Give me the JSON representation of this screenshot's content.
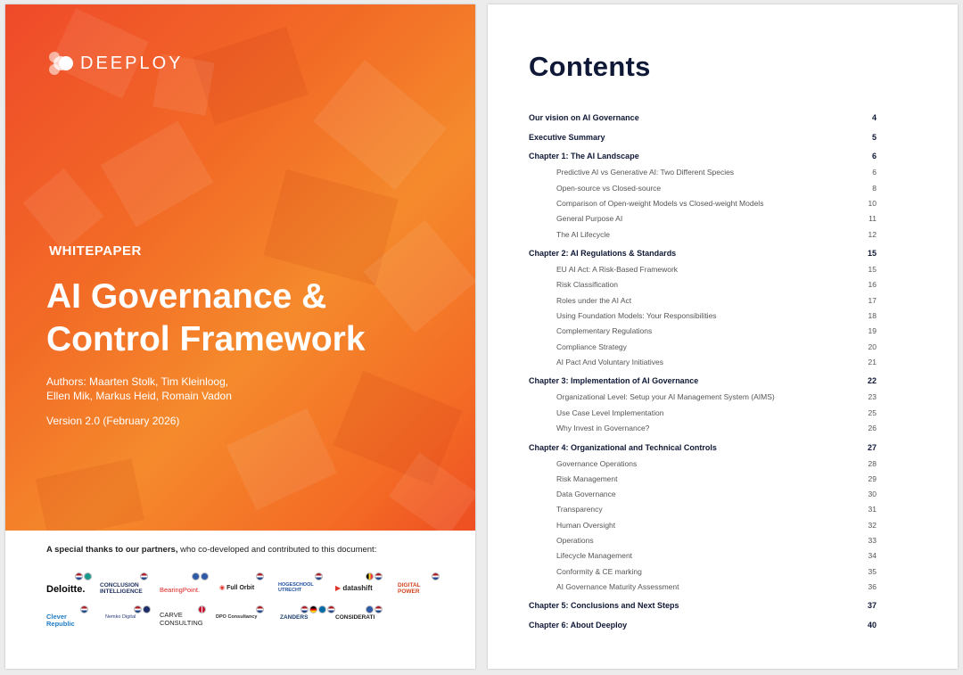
{
  "cover": {
    "logo_text": "DEEPLOY",
    "label": "WHITEPAPER",
    "title_line1": "AI Governance &",
    "title_line2": "Control Framework",
    "authors_line1": "Authors: Maarten Stolk, Tim Kleinloog,",
    "authors_line2": "Ellen Mik, Markus Heid, Romain Vadon",
    "version": "Version 2.0 (February 2026)",
    "thanks_bold": "A special thanks to our partners,",
    "thanks_rest": " who co-developed and contributed to this document:",
    "partners": [
      {
        "name": "Deloitte."
      },
      {
        "name": "CONCLUSION INTELLIGENCE"
      },
      {
        "name": "BearingPoint."
      },
      {
        "name": "Full Orbit"
      },
      {
        "name": "HOGESCHOOL UTRECHT"
      },
      {
        "name": "datashift"
      },
      {
        "name": "DIGITAL POWER"
      },
      {
        "name": "Clever Republic"
      },
      {
        "name": "Nemko Digital"
      },
      {
        "name": "CARVE CONSULTING"
      },
      {
        "name": "DPO Consultancy"
      },
      {
        "name": "ZANDERS"
      },
      {
        "name": "CONSIDERATI"
      }
    ]
  },
  "contents": {
    "title": "Contents",
    "entries": [
      {
        "text": "Our vision on AI Governance",
        "page": "4",
        "level": "h"
      },
      {
        "text": "Executive Summary",
        "page": "5",
        "level": "h"
      },
      {
        "text": "Chapter 1: The AI Landscape",
        "page": "6",
        "level": "h"
      },
      {
        "text": "Predictive AI vs Generative AI: Two Different Species",
        "page": "6",
        "level": "s"
      },
      {
        "text": "Open-source vs Closed-source",
        "page": "8",
        "level": "s"
      },
      {
        "text": "Comparison of Open-weight Models vs Closed-weight Models",
        "page": "10",
        "level": "s"
      },
      {
        "text": "General Purpose AI",
        "page": "11",
        "level": "s"
      },
      {
        "text": "The AI Lifecycle",
        "page": "12",
        "level": "s"
      },
      {
        "text": "Chapter 2: AI Regulations & Standards",
        "page": "15",
        "level": "h"
      },
      {
        "text": "EU AI Act: A Risk-Based Framework",
        "page": "15",
        "level": "s"
      },
      {
        "text": "Risk Classification",
        "page": "16",
        "level": "s"
      },
      {
        "text": "Roles under the AI Act",
        "page": "17",
        "level": "s"
      },
      {
        "text": "Using Foundation Models: Your Responsibilities",
        "page": "18",
        "level": "s"
      },
      {
        "text": "Complementary Regulations",
        "page": "19",
        "level": "s"
      },
      {
        "text": "Compliance Strategy",
        "page": "20",
        "level": "s"
      },
      {
        "text": "AI Pact And Voluntary Initiatives",
        "page": "21",
        "level": "s"
      },
      {
        "text": "Chapter 3: Implementation of AI Governance",
        "page": "22",
        "level": "h"
      },
      {
        "text": "Organizational Level: Setup your AI Management System (AIMS)",
        "page": "23",
        "level": "s"
      },
      {
        "text": "Use Case Level Implementation",
        "page": "25",
        "level": "s"
      },
      {
        "text": "Why Invest in Governance?",
        "page": "26",
        "level": "s"
      },
      {
        "text": "Chapter 4: Organizational and Technical Controls",
        "page": "27",
        "level": "h"
      },
      {
        "text": "Governance Operations",
        "page": "28",
        "level": "s"
      },
      {
        "text": "Risk Management",
        "page": "29",
        "level": "s"
      },
      {
        "text": "Data Governance",
        "page": "30",
        "level": "s"
      },
      {
        "text": "Transparency",
        "page": "31",
        "level": "s"
      },
      {
        "text": "Human Oversight",
        "page": "32",
        "level": "s"
      },
      {
        "text": "Operations",
        "page": "33",
        "level": "s"
      },
      {
        "text": "Lifecycle Management",
        "page": "34",
        "level": "s"
      },
      {
        "text": "Conformity & CE marking",
        "page": "35",
        "level": "s"
      },
      {
        "text": "AI Governance Maturity Assessment",
        "page": "36",
        "level": "s"
      },
      {
        "text": "Chapter 5: Conclusions and Next Steps",
        "page": "37",
        "level": "h"
      },
      {
        "text": "Chapter 6: About Deeploy",
        "page": "40",
        "level": "h"
      }
    ]
  }
}
